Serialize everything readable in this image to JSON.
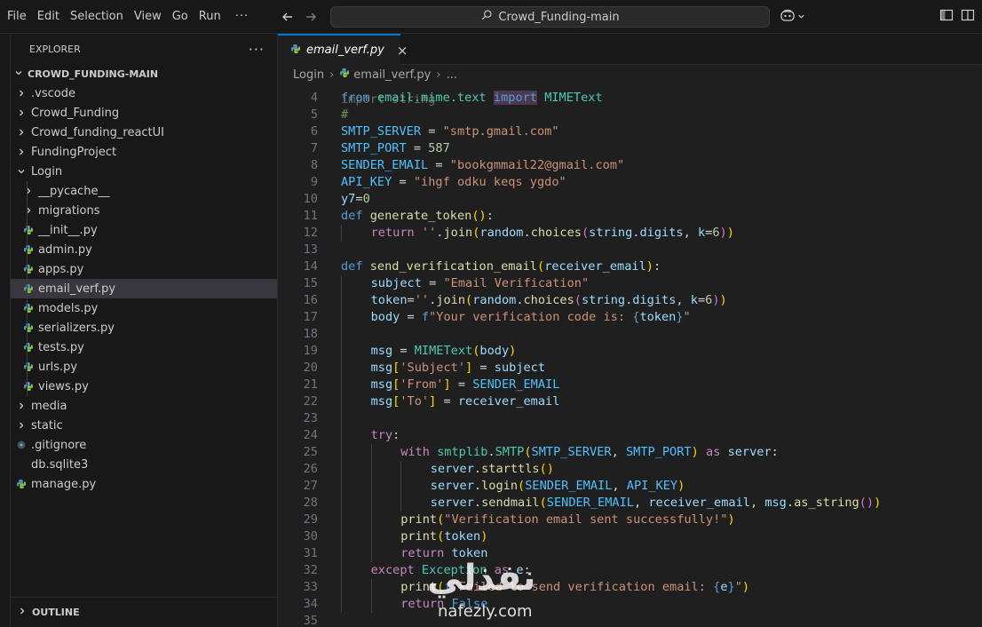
{
  "menu": {
    "items": [
      "File",
      "Edit",
      "Selection",
      "View",
      "Go",
      "Run"
    ],
    "more": "···"
  },
  "search": {
    "label": "Crowd_Funding-main"
  },
  "sidebar": {
    "title": "EXPLORER",
    "more": "···",
    "root": "CROWD_FUNDING-MAIN",
    "tree": [
      {
        "label": ".vscode",
        "type": "folder",
        "expanded": false
      },
      {
        "label": "Crowd_Funding",
        "type": "folder",
        "expanded": false
      },
      {
        "label": "Crowd_funding_reactUI",
        "type": "folder",
        "expanded": false
      },
      {
        "label": "FundingProject",
        "type": "folder",
        "expanded": false
      },
      {
        "label": "Login",
        "type": "folder",
        "expanded": true
      },
      {
        "label": "__pycache__",
        "type": "folder",
        "expanded": false,
        "nested": true
      },
      {
        "label": "migrations",
        "type": "folder",
        "expanded": false,
        "nested": true
      },
      {
        "label": "__init__.py",
        "type": "python",
        "nested": true
      },
      {
        "label": "admin.py",
        "type": "python",
        "nested": true
      },
      {
        "label": "apps.py",
        "type": "python",
        "nested": true
      },
      {
        "label": "email_verf.py",
        "type": "python",
        "nested": true,
        "selected": true
      },
      {
        "label": "models.py",
        "type": "python",
        "nested": true
      },
      {
        "label": "serializers.py",
        "type": "python",
        "nested": true
      },
      {
        "label": "tests.py",
        "type": "python",
        "nested": true
      },
      {
        "label": "urls.py",
        "type": "python",
        "nested": true
      },
      {
        "label": "views.py",
        "type": "python",
        "nested": true
      },
      {
        "label": "media",
        "type": "folder",
        "expanded": false
      },
      {
        "label": "static",
        "type": "folder",
        "expanded": false
      },
      {
        "label": ".gitignore",
        "type": "git"
      },
      {
        "label": "db.sqlite3",
        "type": "db"
      },
      {
        "label": "manage.py",
        "type": "python"
      }
    ],
    "outline": "OUTLINE"
  },
  "tab": {
    "label": "email_verf.py",
    "close": "×"
  },
  "breadcrumb": {
    "folder": "Login",
    "file": "email_verf.py",
    "tail": "..."
  },
  "code": {
    "partial_top": "import string",
    "lines": [
      {
        "n": "4",
        "indent": 0,
        "tokens": [
          [
            "kw",
            "from"
          ],
          [
            "pn",
            " "
          ],
          [
            "cls",
            "email.mime.text"
          ],
          [
            "pn",
            " "
          ],
          [
            "kw hl",
            "import"
          ],
          [
            "pn",
            " "
          ],
          [
            "cls",
            "MIMEText"
          ]
        ]
      },
      {
        "n": "5",
        "indent": 0,
        "tokens": [
          [
            "cmt",
            "#"
          ]
        ]
      },
      {
        "n": "6",
        "indent": 0,
        "tokens": [
          [
            "con",
            "SMTP_SERVER"
          ],
          [
            "pn",
            " = "
          ],
          [
            "str",
            "\"smtp.gmail.com\""
          ]
        ]
      },
      {
        "n": "7",
        "indent": 0,
        "tokens": [
          [
            "con",
            "SMTP_PORT"
          ],
          [
            "pn",
            " = "
          ],
          [
            "num",
            "587"
          ]
        ]
      },
      {
        "n": "8",
        "indent": 0,
        "tokens": [
          [
            "con",
            "SENDER_EMAIL"
          ],
          [
            "pn",
            " = "
          ],
          [
            "str",
            "\"bookgmmail22@gmail.com\""
          ]
        ]
      },
      {
        "n": "9",
        "indent": 0,
        "tokens": [
          [
            "con",
            "API_KEY"
          ],
          [
            "pn",
            " = "
          ],
          [
            "str",
            "\"ihgf odku keqs ygdo\""
          ]
        ]
      },
      {
        "n": "10",
        "indent": 0,
        "tokens": [
          [
            "var",
            "y7"
          ],
          [
            "pn",
            "="
          ],
          [
            "num",
            "0"
          ]
        ]
      },
      {
        "n": "11",
        "indent": 0,
        "tokens": [
          [
            "kw",
            "def"
          ],
          [
            "pn",
            " "
          ],
          [
            "fn",
            "generate_token"
          ],
          [
            "br1",
            "()"
          ],
          [
            "pn",
            ":"
          ]
        ]
      },
      {
        "n": "12",
        "indent": 1,
        "tokens": [
          [
            "ctl",
            "return"
          ],
          [
            "pn",
            " "
          ],
          [
            "str",
            "''"
          ],
          [
            "pn",
            "."
          ],
          [
            "fn",
            "join"
          ],
          [
            "br1",
            "("
          ],
          [
            "var",
            "random"
          ],
          [
            "pn",
            "."
          ],
          [
            "fn",
            "choices"
          ],
          [
            "br2",
            "("
          ],
          [
            "var",
            "string"
          ],
          [
            "pn",
            "."
          ],
          [
            "var",
            "digits"
          ],
          [
            "pn",
            ", "
          ],
          [
            "var",
            "k"
          ],
          [
            "pn",
            "="
          ],
          [
            "num",
            "6"
          ],
          [
            "br2",
            ")"
          ],
          [
            "br1",
            ")"
          ]
        ]
      },
      {
        "n": "13",
        "indent": 0,
        "tokens": []
      },
      {
        "n": "14",
        "indent": 0,
        "tokens": [
          [
            "kw",
            "def"
          ],
          [
            "pn",
            " "
          ],
          [
            "fn",
            "send_verification_email"
          ],
          [
            "br1",
            "("
          ],
          [
            "var",
            "receiver_email"
          ],
          [
            "br1",
            ")"
          ],
          [
            "pn",
            ":"
          ]
        ]
      },
      {
        "n": "15",
        "indent": 1,
        "tokens": [
          [
            "var",
            "subject"
          ],
          [
            "pn",
            " = "
          ],
          [
            "str",
            "\"Email Verification\""
          ]
        ]
      },
      {
        "n": "16",
        "indent": 1,
        "tokens": [
          [
            "var",
            "token"
          ],
          [
            "pn",
            "="
          ],
          [
            "str",
            "''"
          ],
          [
            "pn",
            "."
          ],
          [
            "fn",
            "join"
          ],
          [
            "br1",
            "("
          ],
          [
            "var",
            "random"
          ],
          [
            "pn",
            "."
          ],
          [
            "fn",
            "choices"
          ],
          [
            "br2",
            "("
          ],
          [
            "var",
            "string"
          ],
          [
            "pn",
            "."
          ],
          [
            "var",
            "digits"
          ],
          [
            "pn",
            ", "
          ],
          [
            "var",
            "k"
          ],
          [
            "pn",
            "="
          ],
          [
            "num",
            "6"
          ],
          [
            "br2",
            ")"
          ],
          [
            "br1",
            ")"
          ]
        ]
      },
      {
        "n": "17",
        "indent": 1,
        "tokens": [
          [
            "var",
            "body"
          ],
          [
            "pn",
            " = "
          ],
          [
            "kw",
            "f"
          ],
          [
            "str",
            "\"Your verification code is: "
          ],
          [
            "kw",
            "{"
          ],
          [
            "var",
            "token"
          ],
          [
            "kw",
            "}"
          ],
          [
            "str",
            "\""
          ]
        ]
      },
      {
        "n": "18",
        "indent": 1,
        "tokens": []
      },
      {
        "n": "19",
        "indent": 1,
        "tokens": [
          [
            "var",
            "msg"
          ],
          [
            "pn",
            " = "
          ],
          [
            "cls",
            "MIMEText"
          ],
          [
            "br1",
            "("
          ],
          [
            "var",
            "body"
          ],
          [
            "br1",
            ")"
          ]
        ]
      },
      {
        "n": "20",
        "indent": 1,
        "tokens": [
          [
            "var",
            "msg"
          ],
          [
            "br1",
            "["
          ],
          [
            "str",
            "'Subject'"
          ],
          [
            "br1",
            "]"
          ],
          [
            "pn",
            " = "
          ],
          [
            "var",
            "subject"
          ]
        ]
      },
      {
        "n": "21",
        "indent": 1,
        "tokens": [
          [
            "var",
            "msg"
          ],
          [
            "br1",
            "["
          ],
          [
            "str",
            "'From'"
          ],
          [
            "br1",
            "]"
          ],
          [
            "pn",
            " = "
          ],
          [
            "con",
            "SENDER_EMAIL"
          ]
        ]
      },
      {
        "n": "22",
        "indent": 1,
        "tokens": [
          [
            "var",
            "msg"
          ],
          [
            "br1",
            "["
          ],
          [
            "str",
            "'To'"
          ],
          [
            "br1",
            "]"
          ],
          [
            "pn",
            " = "
          ],
          [
            "var",
            "receiver_email"
          ]
        ]
      },
      {
        "n": "23",
        "indent": 1,
        "tokens": []
      },
      {
        "n": "24",
        "indent": 1,
        "tokens": [
          [
            "ctl",
            "try"
          ],
          [
            "pn",
            ":"
          ]
        ]
      },
      {
        "n": "25",
        "indent": 2,
        "tokens": [
          [
            "ctl",
            "with"
          ],
          [
            "pn",
            " "
          ],
          [
            "cls",
            "smtplib"
          ],
          [
            "pn",
            "."
          ],
          [
            "cls",
            "SMTP"
          ],
          [
            "br1",
            "("
          ],
          [
            "con",
            "SMTP_SERVER"
          ],
          [
            "pn",
            ", "
          ],
          [
            "con",
            "SMTP_PORT"
          ],
          [
            "br1",
            ")"
          ],
          [
            "pn",
            " "
          ],
          [
            "ctl",
            "as"
          ],
          [
            "pn",
            " "
          ],
          [
            "var",
            "server"
          ],
          [
            "pn",
            ":"
          ]
        ]
      },
      {
        "n": "26",
        "indent": 3,
        "tokens": [
          [
            "var",
            "server"
          ],
          [
            "pn",
            "."
          ],
          [
            "fn",
            "starttls"
          ],
          [
            "br1",
            "()"
          ]
        ]
      },
      {
        "n": "27",
        "indent": 3,
        "tokens": [
          [
            "var",
            "server"
          ],
          [
            "pn",
            "."
          ],
          [
            "fn",
            "login"
          ],
          [
            "br1",
            "("
          ],
          [
            "con",
            "SENDER_EMAIL"
          ],
          [
            "pn",
            ", "
          ],
          [
            "con",
            "API_KEY"
          ],
          [
            "br1",
            ")"
          ]
        ]
      },
      {
        "n": "28",
        "indent": 3,
        "tokens": [
          [
            "var",
            "server"
          ],
          [
            "pn",
            "."
          ],
          [
            "fn",
            "sendmail"
          ],
          [
            "br1",
            "("
          ],
          [
            "con",
            "SENDER_EMAIL"
          ],
          [
            "pn",
            ", "
          ],
          [
            "var",
            "receiver_email"
          ],
          [
            "pn",
            ", "
          ],
          [
            "var",
            "msg"
          ],
          [
            "pn",
            "."
          ],
          [
            "fn",
            "as_string"
          ],
          [
            "br2",
            "()"
          ],
          [
            "br1",
            ")"
          ]
        ]
      },
      {
        "n": "29",
        "indent": 2,
        "tokens": [
          [
            "fn",
            "print"
          ],
          [
            "br1",
            "("
          ],
          [
            "str",
            "\"Verification email sent successfully!\""
          ],
          [
            "br1",
            ")"
          ]
        ]
      },
      {
        "n": "30",
        "indent": 2,
        "tokens": [
          [
            "fn",
            "print"
          ],
          [
            "br1",
            "("
          ],
          [
            "var",
            "token"
          ],
          [
            "br1",
            ")"
          ]
        ]
      },
      {
        "n": "31",
        "indent": 2,
        "tokens": [
          [
            "ctl",
            "return"
          ],
          [
            "pn",
            " "
          ],
          [
            "var",
            "token"
          ]
        ]
      },
      {
        "n": "32",
        "indent": 1,
        "tokens": [
          [
            "ctl",
            "except"
          ],
          [
            "pn",
            " "
          ],
          [
            "cls",
            "Exception"
          ],
          [
            "pn",
            " "
          ],
          [
            "ctl",
            "as"
          ],
          [
            "pn",
            " "
          ],
          [
            "var",
            "e"
          ],
          [
            "pn",
            ":"
          ]
        ]
      },
      {
        "n": "33",
        "indent": 2,
        "tokens": [
          [
            "fn",
            "print"
          ],
          [
            "br1",
            "("
          ],
          [
            "kw",
            "f"
          ],
          [
            "str",
            "\"Failed to send verification email: "
          ],
          [
            "kw",
            "{"
          ],
          [
            "var",
            "e"
          ],
          [
            "kw",
            "}"
          ],
          [
            "str",
            "\""
          ],
          [
            "br1",
            ")"
          ]
        ]
      },
      {
        "n": "34",
        "indent": 2,
        "tokens": [
          [
            "ctl",
            "return"
          ],
          [
            "pn",
            " "
          ],
          [
            "kw",
            "False"
          ]
        ]
      },
      {
        "n": "35",
        "indent": 0,
        "tokens": []
      }
    ]
  },
  "watermark": {
    "brand": "نفذلي",
    "site": "nafezly.com"
  },
  "colors": {
    "accent": "#0078d4",
    "background": "#1f1f1f",
    "sidebar": "#181818",
    "selection": "#37373d"
  }
}
